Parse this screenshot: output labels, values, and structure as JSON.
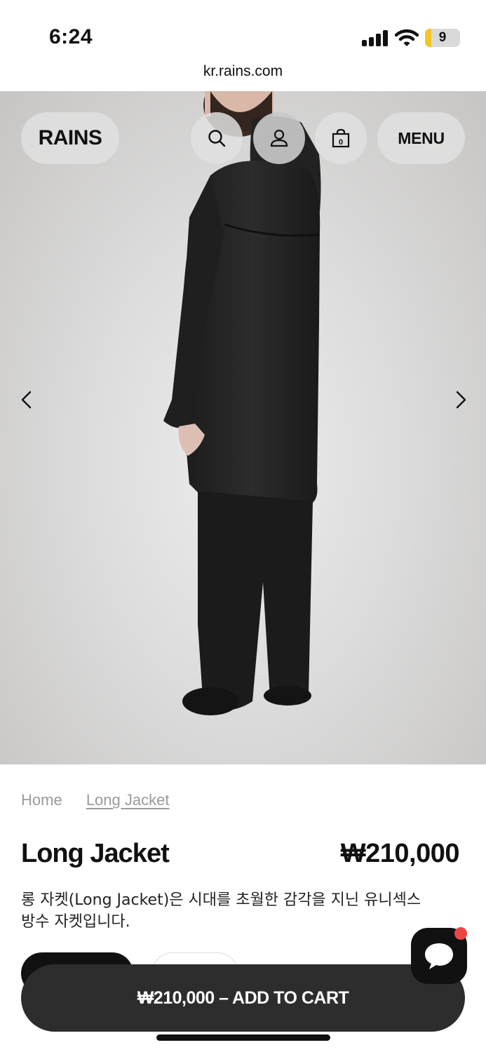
{
  "status_bar": {
    "time": "6:24",
    "battery": "9",
    "battery_level": 0.09
  },
  "browser": {
    "url": "kr.rains.com"
  },
  "header": {
    "logo": "RAINS",
    "menu_label": "MENU",
    "cart_count": "0",
    "icons": [
      "search-icon",
      "account-icon",
      "shopping-bag-icon"
    ]
  },
  "gallery": {
    "prev_icon": "chevron-left-icon",
    "next_icon": "chevron-right-icon"
  },
  "breadcrumb": {
    "home": "Home",
    "current": "Long Jacket"
  },
  "product": {
    "title": "Long Jacket",
    "price": "₩210,000",
    "description_line1": "롱 자켓(Long Jacket)은 시대를 초월한 감각을 지닌 유니섹스",
    "description_line2": "방수 자켓입니다."
  },
  "cart": {
    "label": "₩210,000 – ADD TO CART"
  },
  "chat": {
    "icon": "chat-bubble-icon"
  },
  "colors": {
    "accent": "#111111",
    "cart_bar": "#2d2d2d",
    "notification": "#ef4444",
    "battery": "#f3c623"
  }
}
